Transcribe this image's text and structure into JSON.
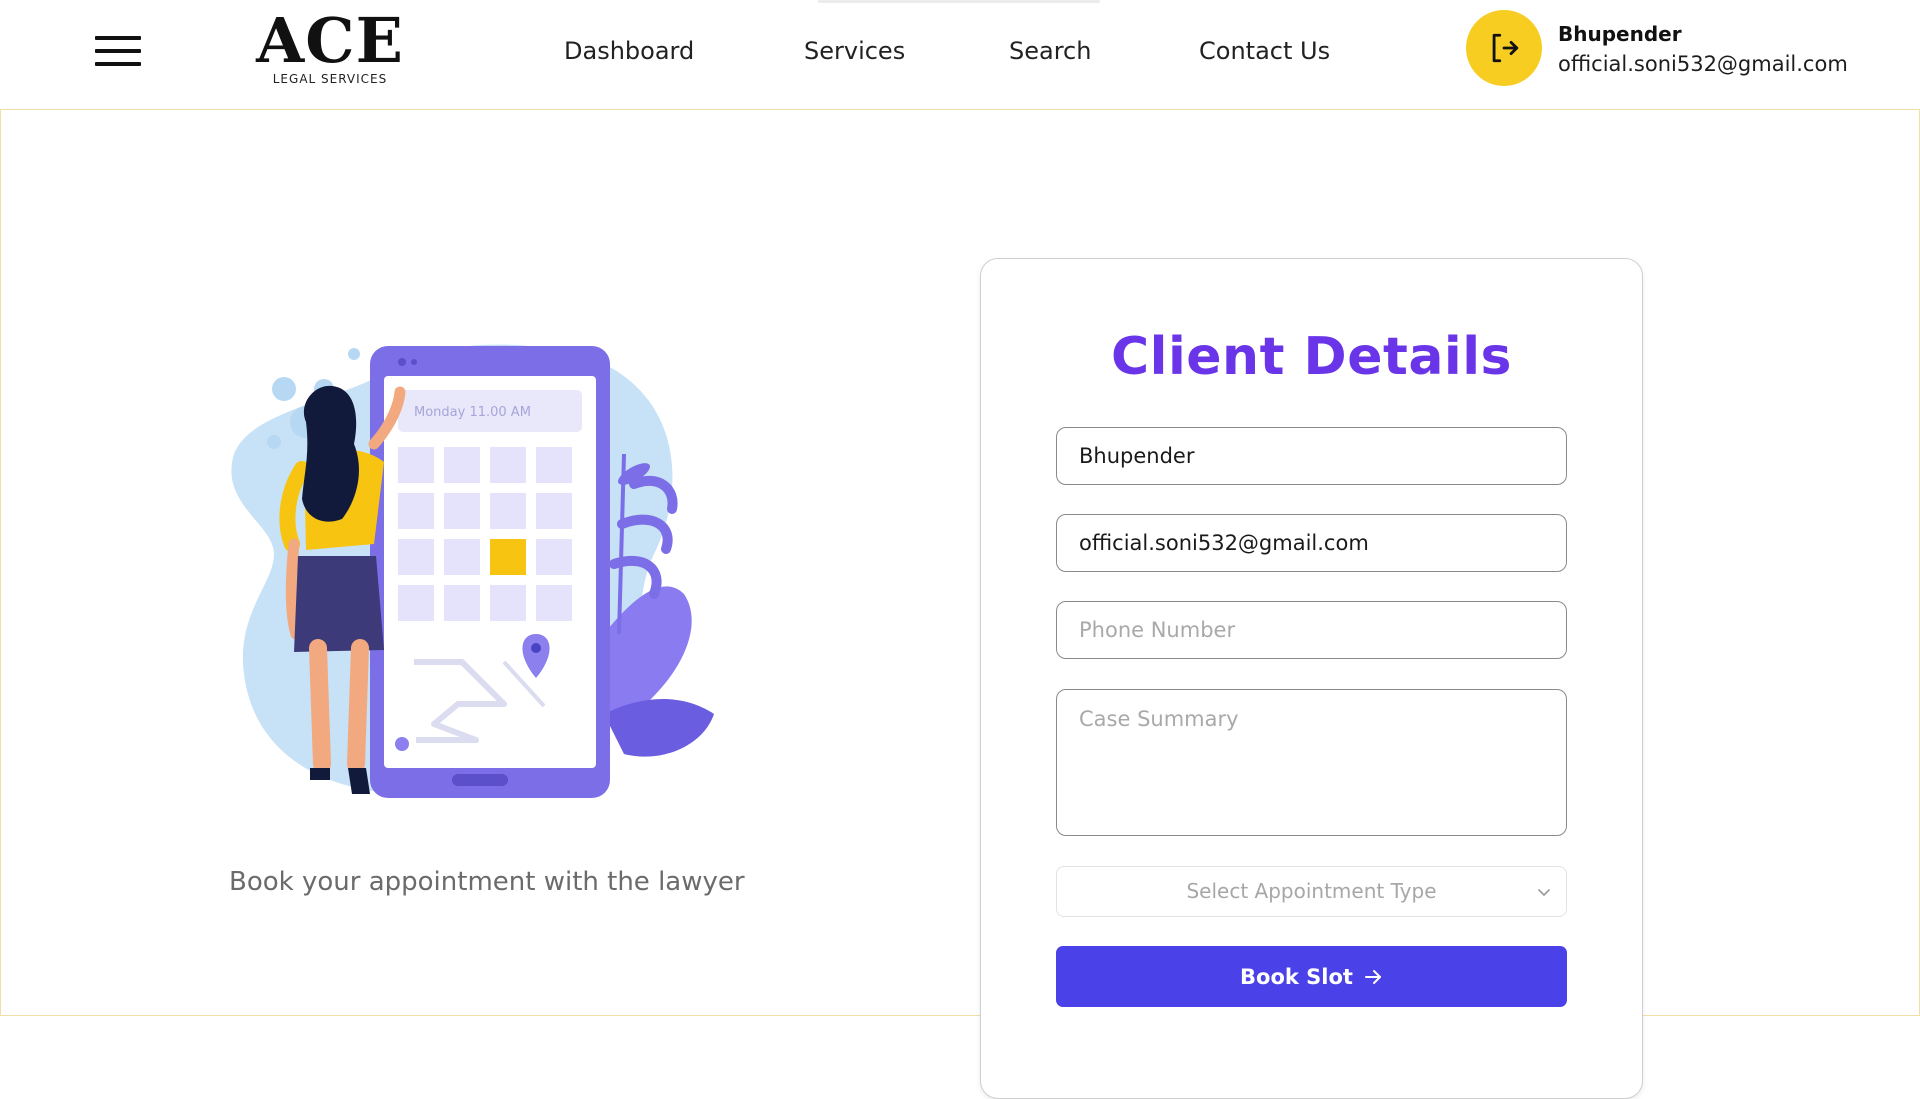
{
  "header": {
    "menu_icon": "hamburger-menu-icon",
    "logo": {
      "main": "ACE",
      "sub": "LEGAL SERVICES"
    },
    "nav": [
      {
        "label": "Dashboard"
      },
      {
        "label": "Services"
      },
      {
        "label": "Search"
      },
      {
        "label": "Contact Us"
      }
    ],
    "logout_icon": "logout-icon",
    "user": {
      "name": "Bhupender",
      "email": "official.soni532@gmail.com"
    }
  },
  "left": {
    "illustration": {
      "icon": "booking-illustration",
      "phone_label": "Monday 11.00 AM"
    },
    "tagline": "Book your appointment with the lawyer"
  },
  "form": {
    "title": "Client Details",
    "name_value": "Bhupender",
    "email_value": "official.soni532@gmail.com",
    "phone_placeholder": "Phone Number",
    "case_placeholder": "Case Summary",
    "select_placeholder": "Select Appointment Type",
    "select_icon": "chevron-down-icon",
    "submit_label": "Book Slot",
    "submit_icon": "arrow-right-icon"
  },
  "colors": {
    "accent_yellow": "#f8cd22",
    "title_purple": "#6a35e8",
    "button_blue": "#4a42e8",
    "illustration_purple": "#7b6ee6",
    "illustration_blue": "#c7e1f6"
  }
}
